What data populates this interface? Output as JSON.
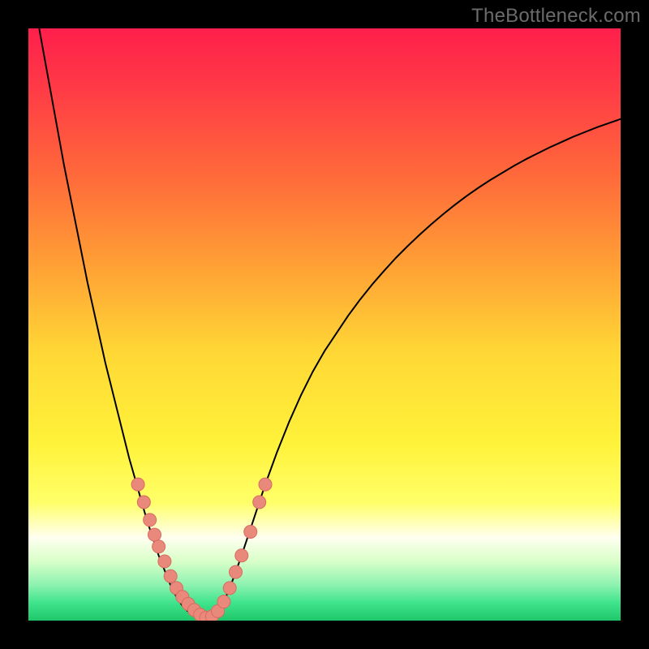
{
  "watermark": "TheBottleneck.com",
  "chart_data": {
    "type": "line",
    "title": "",
    "xlabel": "",
    "ylabel": "",
    "xlim": [
      0,
      100
    ],
    "ylim": [
      0,
      100
    ],
    "background_gradient": {
      "stops": [
        {
          "offset": 0.0,
          "color": "#ff1f4b"
        },
        {
          "offset": 0.1,
          "color": "#ff3a46"
        },
        {
          "offset": 0.25,
          "color": "#ff6a3a"
        },
        {
          "offset": 0.4,
          "color": "#ffa035"
        },
        {
          "offset": 0.55,
          "color": "#ffd835"
        },
        {
          "offset": 0.7,
          "color": "#fff23a"
        },
        {
          "offset": 0.8,
          "color": "#ffff68"
        },
        {
          "offset": 0.86,
          "color": "#fffff0"
        },
        {
          "offset": 0.9,
          "color": "#d8ffc8"
        },
        {
          "offset": 0.94,
          "color": "#8cf2b0"
        },
        {
          "offset": 0.97,
          "color": "#3fe48c"
        },
        {
          "offset": 1.0,
          "color": "#1fc76a"
        }
      ]
    },
    "series": [
      {
        "name": "bottleneck-curve",
        "stroke": "#000000",
        "stroke_width": 2,
        "x": [
          0,
          1,
          2,
          3,
          4,
          5,
          6,
          7,
          8,
          9,
          10,
          11,
          12,
          13,
          14,
          15,
          16,
          17,
          18,
          19,
          20,
          21,
          22,
          23,
          24,
          25,
          26,
          27,
          28,
          29,
          30,
          31,
          32,
          33,
          34,
          35,
          36,
          38,
          40,
          42,
          44,
          46,
          48,
          50,
          52,
          54,
          56,
          58,
          60,
          62,
          64,
          66,
          68,
          70,
          72,
          74,
          76,
          78,
          80,
          82,
          84,
          86,
          88,
          90,
          92,
          94,
          96,
          98,
          100
        ],
        "y": [
          110,
          105,
          99,
          93.5,
          88,
          82.5,
          77,
          72,
          67,
          62,
          57,
          52.5,
          48,
          43.5,
          39.5,
          35.5,
          31.5,
          27.5,
          24,
          20.5,
          17,
          14,
          11,
          8.5,
          6,
          4,
          2.5,
          1.5,
          0.8,
          0.3,
          0,
          0.4,
          1.5,
          3.2,
          5.5,
          8.2,
          11,
          17,
          23,
          28.5,
          33.5,
          38,
          42,
          45.5,
          48.5,
          51.5,
          54.2,
          56.7,
          59,
          61.2,
          63.2,
          65.1,
          66.9,
          68.6,
          70.2,
          71.7,
          73.1,
          74.4,
          75.6,
          76.8,
          77.9,
          78.9,
          79.9,
          80.8,
          81.7,
          82.5,
          83.3,
          84,
          84.7
        ]
      }
    ],
    "scatter": [
      {
        "name": "data-points",
        "fill": "#e9897c",
        "stroke": "#d86b5f",
        "r": 8,
        "points": [
          {
            "x": 18.5,
            "y": 23
          },
          {
            "x": 19.5,
            "y": 20
          },
          {
            "x": 20.5,
            "y": 17
          },
          {
            "x": 21.3,
            "y": 14.5
          },
          {
            "x": 22.0,
            "y": 12.5
          },
          {
            "x": 23.0,
            "y": 10
          },
          {
            "x": 24.0,
            "y": 7.5
          },
          {
            "x": 25.0,
            "y": 5.5
          },
          {
            "x": 26.0,
            "y": 4
          },
          {
            "x": 27.0,
            "y": 2.8
          },
          {
            "x": 28.0,
            "y": 1.8
          },
          {
            "x": 29.0,
            "y": 1.0
          },
          {
            "x": 30.0,
            "y": 0.5
          },
          {
            "x": 31.0,
            "y": 0.7
          },
          {
            "x": 32.0,
            "y": 1.6
          },
          {
            "x": 33.0,
            "y": 3.2
          },
          {
            "x": 34.0,
            "y": 5.5
          },
          {
            "x": 35.0,
            "y": 8.2
          },
          {
            "x": 36.0,
            "y": 11
          },
          {
            "x": 37.5,
            "y": 15
          },
          {
            "x": 39.0,
            "y": 20
          },
          {
            "x": 40.0,
            "y": 23
          }
        ]
      }
    ]
  }
}
